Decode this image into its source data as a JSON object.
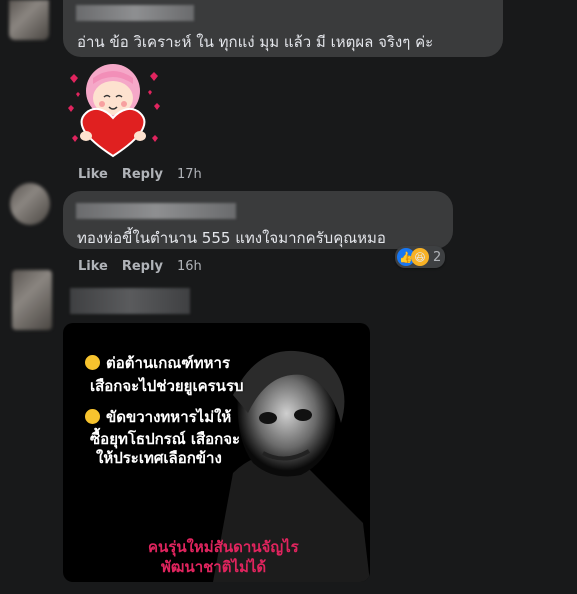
{
  "comment1": {
    "text": "อ่าน ข้อ วิเคราะห์ ใน ทุกแง่ มุม แล้ว มี เหตุผล จริงๆ ค่ะ",
    "like": "Like",
    "reply": "Reply",
    "time": "17h"
  },
  "comment2": {
    "text": "ทองห่อขี้ในตำนาน 555 แทงใจมากครับคุณหมอ",
    "like": "Like",
    "reply": "Reply",
    "time": "16h",
    "reaction_count": "2"
  },
  "meme": {
    "line1": "ต่อต้านเกณฑ์ทหาร",
    "line2": "เสือกจะไปช่วยยูเครนรบ",
    "line3": "ขัดขวางทหารไม่ให้",
    "line4": "ซื้อยุทโธปกรณ์ เสือกจะ",
    "line5": "ให้ประเทศเลือกข้าง",
    "line6": "คนรุ่นใหม่สันดานจัญไร",
    "line7": "พัฒนาชาติไม่ได้"
  },
  "colors": {
    "background": "#18191a",
    "bubble": "#3a3b3c",
    "muted_text": "#b0b3b8",
    "like_blue": "#1877f2",
    "meme_red": "#e0245e"
  },
  "icons": [
    "thumbs-up-icon",
    "haha-icon",
    "laughing-emoji-icon"
  ]
}
